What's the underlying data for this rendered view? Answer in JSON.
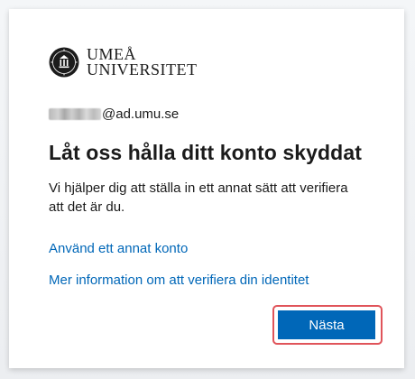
{
  "logo": {
    "line1": "UMEÅ",
    "line2": "UNIVERSITET",
    "icon": "university-seal-icon"
  },
  "identity": {
    "email_suffix": "@ad.umu.se"
  },
  "title": "Låt oss hålla ditt konto skyddat",
  "description": "Vi hjälper dig att ställa in ett annat sätt att verifiera att det är du.",
  "links": {
    "other_account": "Använd ett annat konto",
    "more_info": "Mer information om att verifiera din identitet"
  },
  "buttons": {
    "next_label": "Nästa"
  },
  "colors": {
    "link": "#0067b8",
    "primary_button": "#0067b8",
    "highlight_border": "#e0545a"
  }
}
